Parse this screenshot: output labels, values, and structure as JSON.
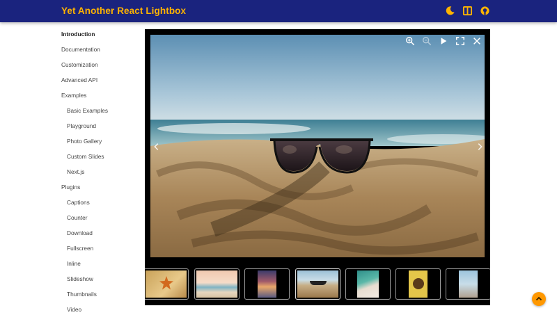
{
  "app": {
    "title": "Yet Another React Lightbox"
  },
  "header_icons": [
    "theme-toggle-icon",
    "docs-book-icon",
    "github-icon"
  ],
  "sidebar": {
    "items": [
      {
        "label": "Introduction",
        "active": true
      },
      {
        "label": "Documentation"
      },
      {
        "label": "Customization"
      },
      {
        "label": "Advanced API"
      },
      {
        "label": "Examples"
      },
      {
        "label": "Basic Examples"
      },
      {
        "label": "Playground"
      },
      {
        "label": "Photo Gallery"
      },
      {
        "label": "Custom Slides"
      },
      {
        "label": "Next.js"
      },
      {
        "label": "Plugins"
      },
      {
        "label": "Captions"
      },
      {
        "label": "Counter"
      },
      {
        "label": "Download"
      },
      {
        "label": "Fullscreen"
      },
      {
        "label": "Inline"
      },
      {
        "label": "Slideshow"
      },
      {
        "label": "Thumbnails"
      },
      {
        "label": "Video"
      }
    ]
  },
  "lightbox": {
    "toolbar": [
      "zoom-in-icon",
      "zoom-out-icon",
      "play-icon",
      "fullscreen-icon",
      "close-icon"
    ],
    "nav": [
      "previous-arrow-icon",
      "next-arrow-icon"
    ],
    "thumbnails": [
      {
        "name": "starfish"
      },
      {
        "name": "beach-sunset"
      },
      {
        "name": "dusk-shore"
      },
      {
        "name": "sunglasses-on-sand",
        "selected": true
      },
      {
        "name": "aerial-beach"
      },
      {
        "name": "sunflower-person"
      },
      {
        "name": "pier-portrait"
      }
    ]
  },
  "colors": {
    "appbar": "#1a237e",
    "accent": "#ffb300",
    "fab": "#ff9800"
  }
}
